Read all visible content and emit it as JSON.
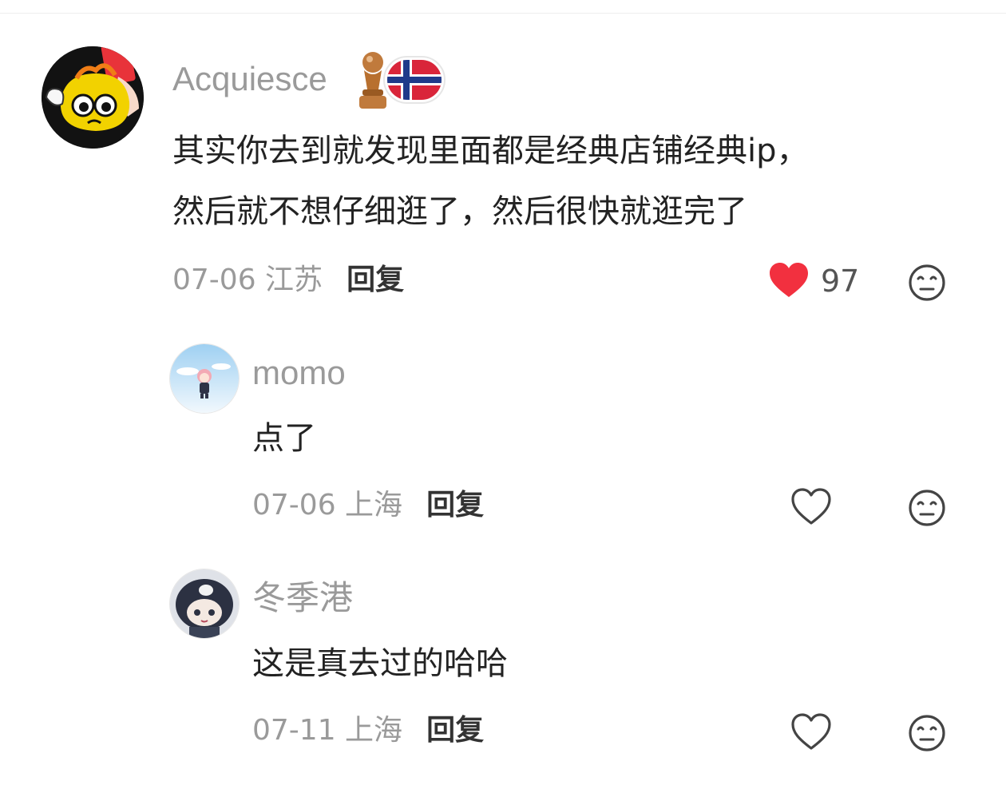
{
  "colors": {
    "like_active": "#f2303f",
    "muted_text": "#9a9a9a",
    "icon_stroke": "#444444"
  },
  "comments": [
    {
      "username": "Acquiesce",
      "badges": [
        "trophy-icon",
        "norway-flag-icon"
      ],
      "avatar_icon": "red-card-cartoon-avatar",
      "lines": [
        "其实你去到就发现里面都是经典店铺经典ip，",
        "然后就不想仔细逛了，然后很快就逛完了"
      ],
      "date_location": "07-06 江苏",
      "reply_label": "回复",
      "likes": "97",
      "liked": true
    },
    {
      "username": "momo",
      "avatar_icon": "pink-hair-chibi-avatar",
      "lines": [
        "点了"
      ],
      "date_location": "07-06 上海",
      "reply_label": "回复",
      "liked": false
    },
    {
      "username": "冬季港",
      "avatar_icon": "dark-hair-plush-avatar",
      "lines": [
        "这是真去过的哈哈"
      ],
      "date_location": "07-11 上海",
      "reply_label": "回复",
      "liked": false
    }
  ]
}
